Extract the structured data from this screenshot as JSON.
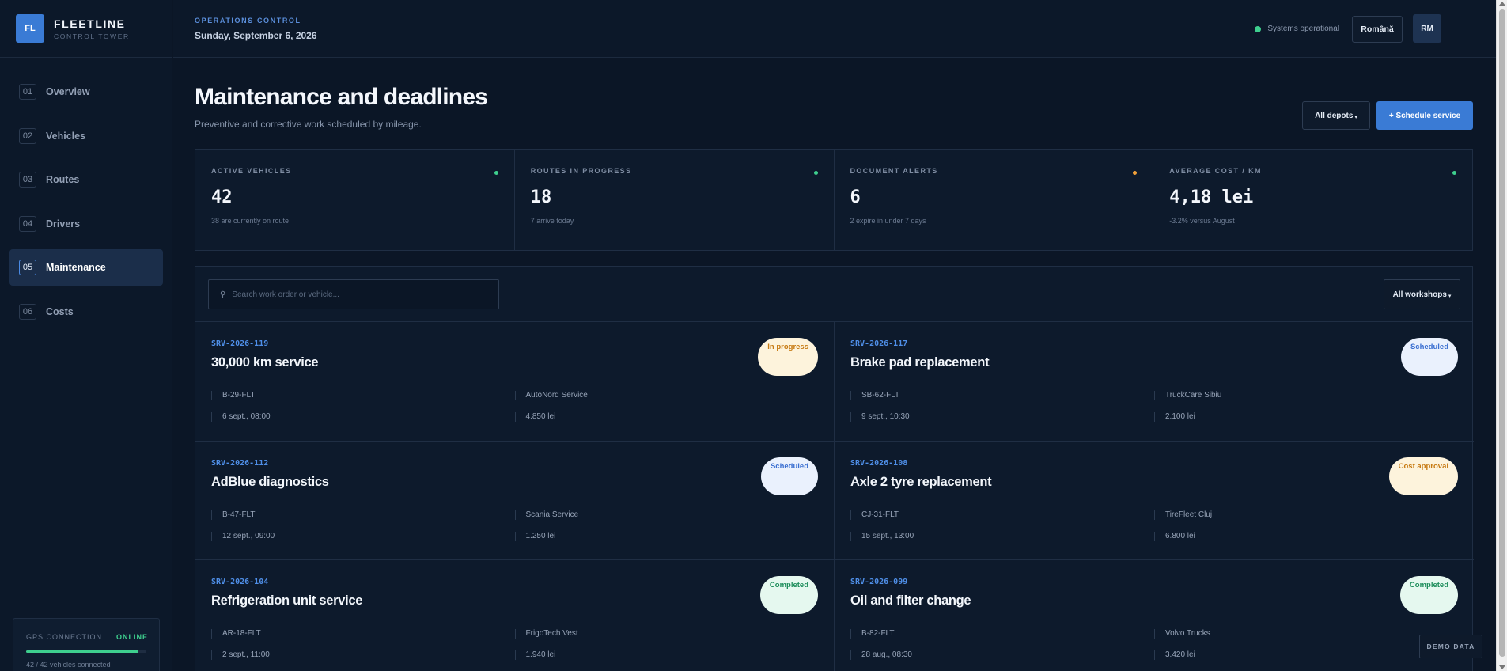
{
  "brand": {
    "logo": "FL",
    "name": "FLEETLINE",
    "tagline": "CONTROL TOWER"
  },
  "nav": [
    {
      "num": "01",
      "label": "Overview"
    },
    {
      "num": "02",
      "label": "Vehicles"
    },
    {
      "num": "03",
      "label": "Routes"
    },
    {
      "num": "04",
      "label": "Drivers"
    },
    {
      "num": "05",
      "label": "Maintenance",
      "active": true
    },
    {
      "num": "06",
      "label": "Costs"
    }
  ],
  "gps": {
    "label": "GPS CONNECTION",
    "status": "ONLINE",
    "connected_fraction": 0.93,
    "count": "42 / 42 vehicles connected"
  },
  "topbar": {
    "eyebrow": "OPERATIONS CONTROL",
    "date": "Sunday, September 6, 2026",
    "system_status": "Systems operational",
    "language": "Română",
    "avatar": "RM"
  },
  "page": {
    "title": "Maintenance and deadlines",
    "subtitle": "Preventive and corrective work scheduled by mileage.",
    "depot_filter": "All depots",
    "schedule_button": "+ Schedule service"
  },
  "kpis": [
    {
      "label": "ACTIVE VEHICLES",
      "value": "42",
      "note": "38 are currently on route",
      "dot": "#3ecf8e"
    },
    {
      "label": "ROUTES IN PROGRESS",
      "value": "18",
      "note": "7 arrive today",
      "dot": "#3ecf8e"
    },
    {
      "label": "DOCUMENT ALERTS",
      "value": "6",
      "note": "2 expire in under 7 days",
      "dot": "#f0a03a"
    },
    {
      "label": "AVERAGE COST / KM",
      "value": "4,18 lei",
      "note": "-3.2% versus August",
      "dot": "#3ecf8e"
    }
  ],
  "search": {
    "placeholder": "Search work order or vehicle..."
  },
  "workshop_filter": "All workshops",
  "orders": [
    {
      "id": "SRV-2026-119",
      "title": "30,000 km service",
      "status": "In progress",
      "status_type": "progress",
      "vehicle": "B-29-FLT",
      "workshop": "AutoNord Service",
      "date": "6 sept., 08:00",
      "cost": "4.850 lei"
    },
    {
      "id": "SRV-2026-117",
      "title": "Brake pad replacement",
      "status": "Scheduled",
      "status_type": "scheduled",
      "vehicle": "SB-62-FLT",
      "workshop": "TruckCare Sibiu",
      "date": "9 sept., 10:30",
      "cost": "2.100 lei"
    },
    {
      "id": "SRV-2026-112",
      "title": "AdBlue diagnostics",
      "status": "Scheduled",
      "status_type": "scheduled",
      "vehicle": "B-47-FLT",
      "workshop": "Scania Service",
      "date": "12 sept., 09:00",
      "cost": "1.250 lei"
    },
    {
      "id": "SRV-2026-108",
      "title": "Axle 2 tyre replacement",
      "status": "Cost approval",
      "status_type": "approval",
      "vehicle": "CJ-31-FLT",
      "workshop": "TireFleet Cluj",
      "date": "15 sept., 13:00",
      "cost": "6.800 lei"
    },
    {
      "id": "SRV-2026-104",
      "title": "Refrigeration unit service",
      "status": "Completed",
      "status_type": "completed",
      "vehicle": "AR-18-FLT",
      "workshop": "FrigoTech Vest",
      "date": "2 sept., 11:00",
      "cost": "1.940 lei"
    },
    {
      "id": "SRV-2026-099",
      "title": "Oil and filter change",
      "status": "Completed",
      "status_type": "completed",
      "vehicle": "B-82-FLT",
      "workshop": "Volvo Trucks",
      "date": "28 aug., 08:30",
      "cost": "3.420 lei"
    }
  ],
  "demo_label": "DEMO DATA",
  "icons": {
    "search": "search-icon",
    "chevron": "chevron-down-icon",
    "status_dot": "status-dot-icon"
  }
}
